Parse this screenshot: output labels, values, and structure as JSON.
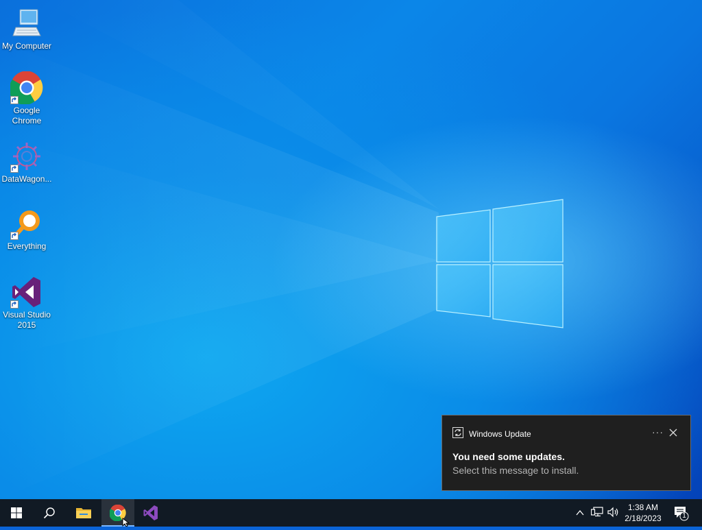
{
  "desktop": {
    "icons": [
      {
        "label": "My Computer",
        "icon": "computer-icon"
      },
      {
        "label": "Google Chrome",
        "icon": "chrome-icon"
      },
      {
        "label": "DataWagon...",
        "icon": "datawagon-icon"
      },
      {
        "label": "Everything",
        "icon": "everything-search-icon"
      },
      {
        "label": "Visual Studio 2015",
        "icon": "visual-studio-icon"
      }
    ]
  },
  "toast": {
    "app_name": "Windows Update",
    "app_icon": "update-icon",
    "more_label": "···",
    "title": "You need some updates.",
    "message": "Select this message to install."
  },
  "taskbar": {
    "items": [
      {
        "name": "start",
        "icon": "windows-start-icon"
      },
      {
        "name": "search",
        "icon": "search-icon"
      },
      {
        "name": "file-explorer",
        "icon": "folder-icon"
      },
      {
        "name": "chrome",
        "icon": "chrome-icon",
        "active": true
      },
      {
        "name": "visual-studio",
        "icon": "visual-studio-icon"
      }
    ],
    "tray": {
      "time": "1:38 AM",
      "date": "2/18/2023",
      "notification_count": "1"
    }
  },
  "colors": {
    "taskbar_bg": "#111a24",
    "toast_bg": "#1f1f1f",
    "accent": "#7ab7ff"
  }
}
